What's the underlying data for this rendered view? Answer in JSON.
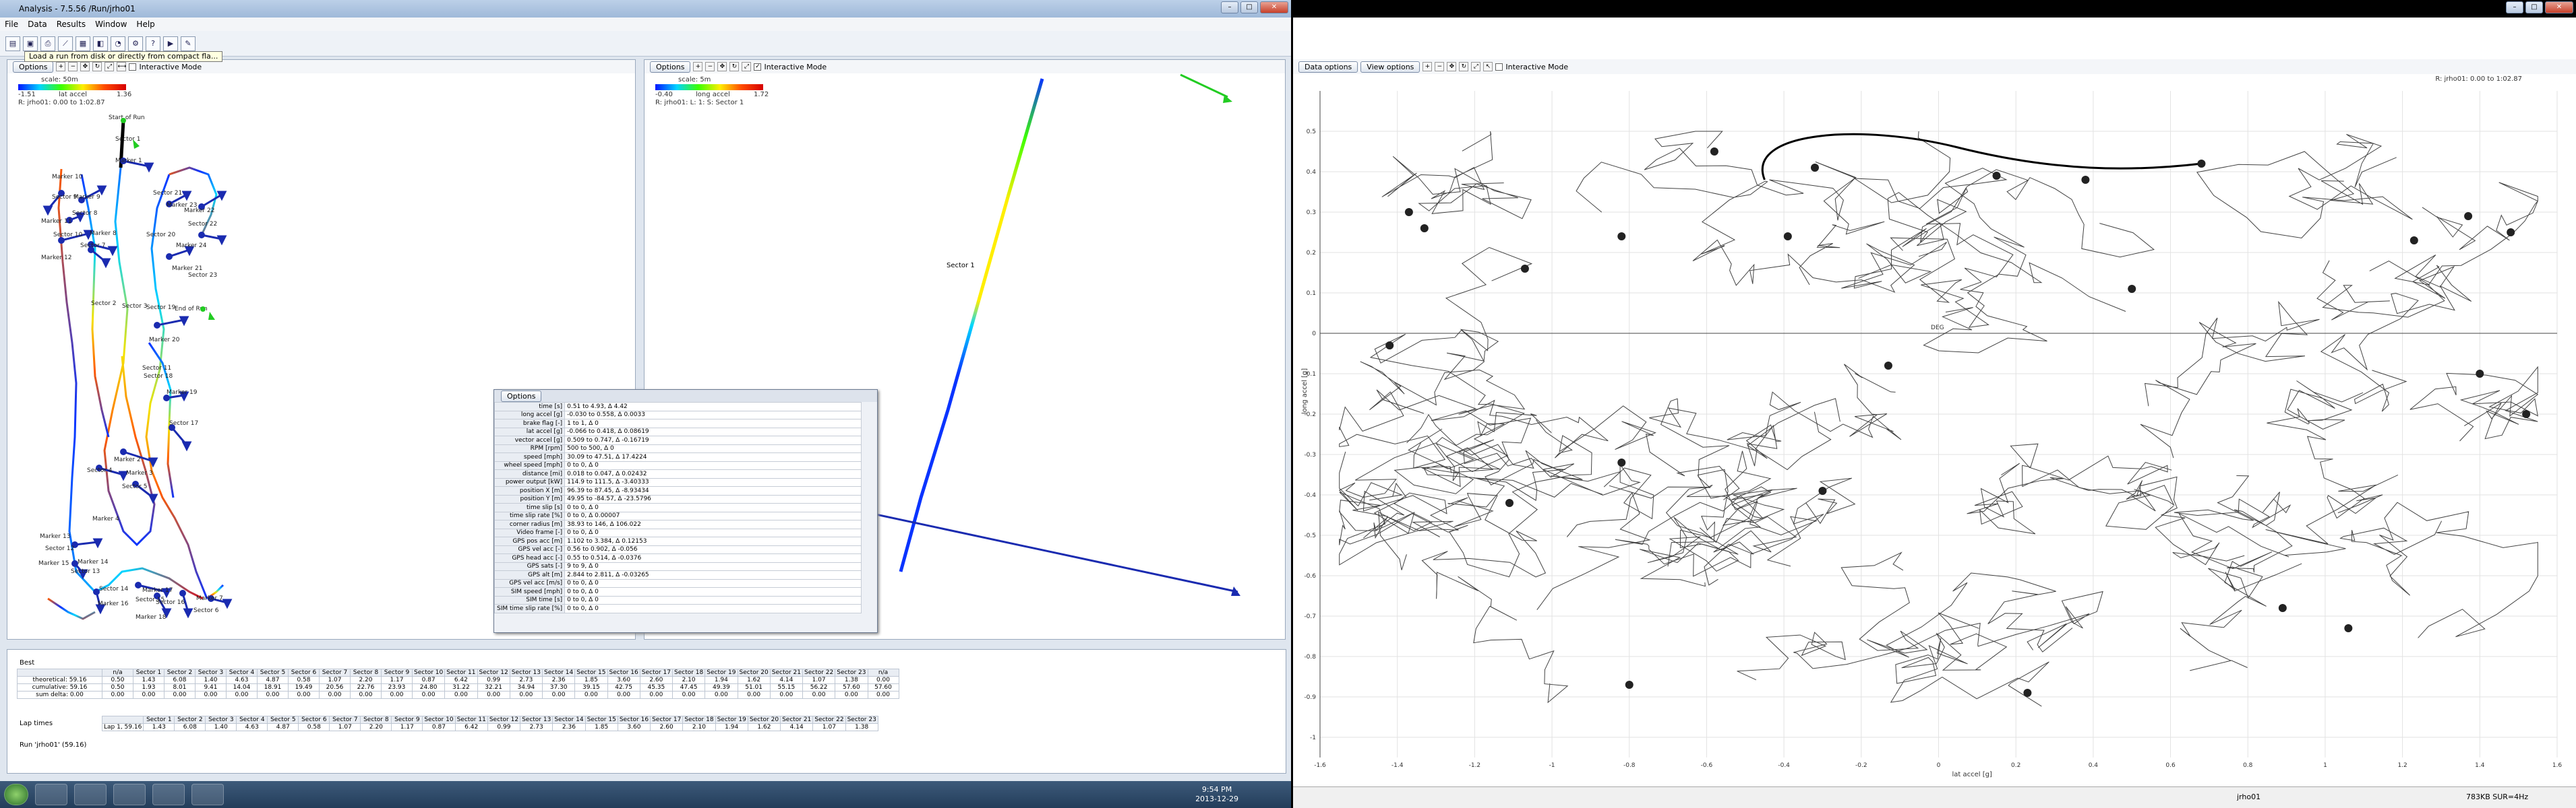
{
  "left_window": {
    "title": "Analysis - 7.5.56 /Run/jrho01",
    "menu": [
      "File",
      "Data",
      "Results",
      "Window",
      "Help"
    ],
    "tooltip": "Load a run from disk or directly from compact fla...",
    "toolbar_icons": [
      "open-icon",
      "save-icon",
      "print-icon",
      "chart-icon",
      "table-icon",
      "map-icon",
      "gauge-icon",
      "settings-icon",
      "help-icon"
    ]
  },
  "track_pane": {
    "options_label": "Options",
    "interactive_label": "Interactive Mode",
    "scale_label": "scale: 50m",
    "legend_min": "-1.51",
    "legend_name": "lat accel",
    "legend_max": "1.36",
    "run_label": "R: jrho01: 0.00 to 1:02.87",
    "labels": [
      "Start of Run",
      "Sector 1",
      "Marker 1",
      "Marker 10",
      "Sector 9",
      "Marker 9",
      "Sector 8",
      "Marker 11",
      "Sector 10",
      "Marker 8",
      "Sector 7",
      "Marker 12",
      "Sector 2",
      "Sector 3",
      "Sector 11",
      "Sector 21",
      "Marker 23",
      "Marker 22",
      "Sector 20",
      "Sector 22",
      "Marker 24",
      "Marker 21",
      "Sector 23",
      "Sector 19",
      "End of Run",
      "Marker 20",
      "Sector 18",
      "Marker 19",
      "Sector 17",
      "Marker 2",
      "Sector 4",
      "Marker 3",
      "Sector 5",
      "Marker 4",
      "Marker 13",
      "Sector 12",
      "Marker 14",
      "Sector 13",
      "Marker 15",
      "Sector 14",
      "Marker 16",
      "Sector 15",
      "Marker 17",
      "Sector 16",
      "Marker 18",
      "Marker 7",
      "Sector 6"
    ]
  },
  "zoom_pane": {
    "options_label": "Options",
    "interactive_label": "Interactive Mode",
    "scale_label": "scale: 5m",
    "legend_min": "-0.40",
    "legend_name": "long accel",
    "legend_max": "1.72",
    "run_label": "R: jrho01: L: 1: S: Sector 1",
    "sector_label": "Sector 1"
  },
  "overlay": {
    "options_label": "Options",
    "rows": [
      {
        "k": "time [s]",
        "v": "0.51 to 4.93, Δ 4.42"
      },
      {
        "k": "long accel [g]",
        "v": "-0.030 to 0.558, Δ 0.0033"
      },
      {
        "k": "brake flag [-]",
        "v": "1 to 1, Δ 0"
      },
      {
        "k": "lat accel [g]",
        "v": "-0.066 to 0.418, Δ 0.08619"
      },
      {
        "k": "vector accel [g]",
        "v": "0.509 to 0.747, Δ -0.16719"
      },
      {
        "k": "RPM [rpm]",
        "v": "500 to 500, Δ 0"
      },
      {
        "k": "speed [mph]",
        "v": "30.09 to 47.51, Δ 17.4224"
      },
      {
        "k": "wheel speed [mph]",
        "v": "0 to 0, Δ 0"
      },
      {
        "k": "distance [mi]",
        "v": "0.018 to 0.047, Δ 0.02432"
      },
      {
        "k": "power output [kW]",
        "v": "114.9 to 111.5, Δ -3.40333"
      },
      {
        "k": "position X [m]",
        "v": "96.39 to 87.45, Δ -8.93434"
      },
      {
        "k": "position Y [m]",
        "v": "49.95 to -84.57, Δ -23.5796"
      },
      {
        "k": "time slip [s]",
        "v": "0 to 0, Δ 0"
      },
      {
        "k": "time slip rate [%]",
        "v": "0 to 0, Δ 0.00007"
      },
      {
        "k": "corner radius [m]",
        "v": "38.93 to 146, Δ 106.022"
      },
      {
        "k": "Video frame [-]",
        "v": "0 to 0, Δ 0"
      },
      {
        "k": "GPS pos acc [m]",
        "v": "1.102 to 3.384, Δ 0.12153"
      },
      {
        "k": "GPS vel acc [-]",
        "v": "0.56 to 0.902, Δ -0.056"
      },
      {
        "k": "GPS head acc [-]",
        "v": "0.55 to 0.514, Δ -0.0376"
      },
      {
        "k": "GPS sats [-]",
        "v": "9 to 9, Δ 0"
      },
      {
        "k": "GPS alt [m]",
        "v": "2.844 to 2.811, Δ -0.03265"
      },
      {
        "k": "GPS vel acc [m/s]",
        "v": "0 to 0, Δ 0"
      },
      {
        "k": "SIM speed [mph]",
        "v": "0 to 0, Δ 0"
      },
      {
        "k": "SIM time [s]",
        "v": "0 to 0, Δ 0"
      },
      {
        "k": "SIM time slip rate [%]",
        "v": "0 to 0, Δ 0"
      }
    ]
  },
  "best_table": {
    "title": "Best",
    "header": [
      "",
      "n/a",
      "Sector 1",
      "Sector 2",
      "Sector 3",
      "Sector 4",
      "Sector 5",
      "Sector 6",
      "Sector 7",
      "Sector 8",
      "Sector 9",
      "Sector 10",
      "Sector 11",
      "Sector 12",
      "Sector 13",
      "Sector 14",
      "Sector 15",
      "Sector 16",
      "Sector 17",
      "Sector 18",
      "Sector 19",
      "Sector 20",
      "Sector 21",
      "Sector 22",
      "Sector 23",
      "n/a"
    ],
    "rows": [
      [
        "theoretical: 59.16",
        "0.50",
        "1.43",
        "6.08",
        "1.40",
        "4.63",
        "4.87",
        "0.58",
        "1.07",
        "2.20",
        "1.17",
        "0.87",
        "6.42",
        "0.99",
        "2.73",
        "2.36",
        "1.85",
        "3.60",
        "2.60",
        "2.10",
        "1.94",
        "1.62",
        "4.14",
        "1.07",
        "1.38",
        "0.00"
      ],
      [
        "cumulative: 59.16",
        "0.50",
        "1.93",
        "8.01",
        "9.41",
        "14.04",
        "18.91",
        "19.49",
        "20.56",
        "22.76",
        "23.93",
        "24.80",
        "31.22",
        "32.21",
        "34.94",
        "37.30",
        "39.15",
        "42.75",
        "45.35",
        "47.45",
        "49.39",
        "51.01",
        "55.15",
        "56.22",
        "57.60",
        "57.60"
      ],
      [
        "sum delta: 0.00",
        "0.00",
        "0.00",
        "0.00",
        "0.00",
        "0.00",
        "0.00",
        "0.00",
        "0.00",
        "0.00",
        "0.00",
        "0.00",
        "0.00",
        "0.00",
        "0.00",
        "0.00",
        "0.00",
        "0.00",
        "0.00",
        "0.00",
        "0.00",
        "0.00",
        "0.00",
        "0.00",
        "0.00",
        "0.00"
      ]
    ]
  },
  "lap_table": {
    "title": "Lap times",
    "run_label": "Run 'jrho01' (59.16)",
    "header": [
      "",
      "Sector 1",
      "Sector 2",
      "Sector 3",
      "Sector 4",
      "Sector 5",
      "Sector 6",
      "Sector 7",
      "Sector 8",
      "Sector 9",
      "Sector 10",
      "Sector 11",
      "Sector 12",
      "Sector 13",
      "Sector 14",
      "Sector 15",
      "Sector 16",
      "Sector 17",
      "Sector 18",
      "Sector 19",
      "Sector 20",
      "Sector 21",
      "Sector 22",
      "Sector 23"
    ],
    "row": [
      "Lap 1, 59.16",
      "1.43",
      "6.08",
      "1.40",
      "4.63",
      "4.87",
      "0.58",
      "1.07",
      "2.20",
      "1.17",
      "0.87",
      "6.42",
      "0.99",
      "2.73",
      "2.36",
      "1.85",
      "3.60",
      "2.60",
      "2.10",
      "1.94",
      "1.62",
      "4.14",
      "1.07",
      "1.38"
    ]
  },
  "taskbar": {
    "time": "9:54 PM",
    "date": "2013-12-29"
  },
  "right_window": {
    "tabs": [
      "Data options",
      "View options"
    ],
    "interactive_label": "Interactive Mode",
    "run_label": "R: jrho01: 0.00 to 1:02.87",
    "ylabel": "long accel [g]",
    "xlabel": "lat accel [g]",
    "center_label": "DEG",
    "status_left": "jrho01",
    "status_right": "783KB SUR=4Hz"
  },
  "chart_data": {
    "type": "scatter",
    "title": "",
    "xlabel": "lat accel [g]",
    "ylabel": "long accel [g]",
    "xlim": [
      -1.6,
      1.6
    ],
    "ylim": [
      -1.05,
      0.6
    ],
    "x_ticks": [
      "-1.6",
      "-1.4",
      "-1.2",
      "-1",
      "-0.8",
      "-0.6",
      "-0.4",
      "-0.2",
      "0",
      "0.2",
      "0.4",
      "0.6",
      "0.8",
      "1",
      "1.2",
      "1.4",
      "1.6"
    ],
    "y_ticks": [
      "0.5",
      "0.4",
      "0.3",
      "0.2",
      "0.1",
      "0",
      "-0.1",
      "-0.2",
      "-0.3",
      "-0.4",
      "-0.5",
      "-0.6",
      "-0.7",
      "-0.8",
      "-0.9",
      "-1"
    ],
    "grid": true,
    "markers": [
      {
        "x": -0.58,
        "y": 0.45
      },
      {
        "x": -0.32,
        "y": 0.41
      },
      {
        "x": 0.15,
        "y": 0.39
      },
      {
        "x": 0.38,
        "y": 0.38
      },
      {
        "x": 0.68,
        "y": 0.42
      },
      {
        "x": -1.37,
        "y": 0.3
      },
      {
        "x": -1.33,
        "y": 0.26
      },
      {
        "x": -0.82,
        "y": 0.24
      },
      {
        "x": -1.07,
        "y": 0.16
      },
      {
        "x": -0.39,
        "y": 0.24
      },
      {
        "x": 0.5,
        "y": 0.11
      },
      {
        "x": 1.37,
        "y": 0.29
      },
      {
        "x": 1.23,
        "y": 0.23
      },
      {
        "x": 1.48,
        "y": 0.25
      },
      {
        "x": -1.42,
        "y": -0.03
      },
      {
        "x": -0.13,
        "y": -0.08
      },
      {
        "x": 1.4,
        "y": -0.1
      },
      {
        "x": 1.52,
        "y": -0.2
      },
      {
        "x": -0.82,
        "y": -0.32
      },
      {
        "x": -0.3,
        "y": -0.39
      },
      {
        "x": -1.11,
        "y": -0.42
      },
      {
        "x": 0.89,
        "y": -0.68
      },
      {
        "x": 1.06,
        "y": -0.73
      },
      {
        "x": -0.8,
        "y": -0.87
      },
      {
        "x": 0.23,
        "y": -0.89
      }
    ]
  }
}
